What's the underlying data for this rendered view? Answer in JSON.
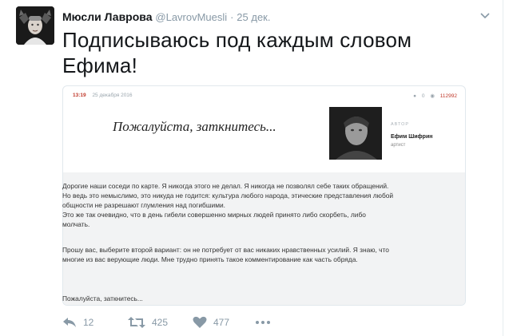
{
  "tweet": {
    "author_name": "Мюсли Лаврова",
    "handle": "@LavrovMuesli",
    "separator": "·",
    "date": "25 дек.",
    "text": "Подписываюсь под каждым словом Ефима!",
    "text_lines": [
      "Подписываюсь под каждым словом",
      "Ефима!"
    ]
  },
  "card": {
    "time": "13:19",
    "date": "25 декабря 2016",
    "comments": "0",
    "views": "112992",
    "headline": "Пожалуйста, заткнитесь...",
    "author_label": "АВТОР",
    "author_name": "Ефим Шифрин",
    "author_role": "артист",
    "paragraphs": [
      [
        "Дорогие наши соседи по карте. Я никогда этого не делал. Я никогда не позволял себе таких обращений.",
        "Но ведь это немыслимо, это никуда не годится: культура любого народа, этические представления любой",
        "общности не разрешают глумления над погибшими.",
        "Это же так очевидно, что в день гибели совершенно мирных людей принято либо скорбеть, либо",
        "молчать."
      ],
      [
        "Прошу вас, выберите второй вариант: он не потребует от вас никаких нравственных усилий. Я знаю, что",
        "многие из вас верующие люди. Мне трудно принять такое комментирование как часть обряда."
      ],
      [
        "Пожалуйста, заткнитесь..."
      ]
    ]
  },
  "actions": {
    "replies": "12",
    "retweets": "425",
    "likes": "477"
  },
  "icons": {
    "avatar": "coat-of-arms-portrait",
    "chevron": "chevron-down-icon",
    "reply": "reply-icon",
    "retweet": "retweet-icon",
    "like": "heart-icon",
    "more": "more-icon"
  },
  "colors": {
    "accent_red": "#c0392b",
    "muted": "#8899a6"
  }
}
